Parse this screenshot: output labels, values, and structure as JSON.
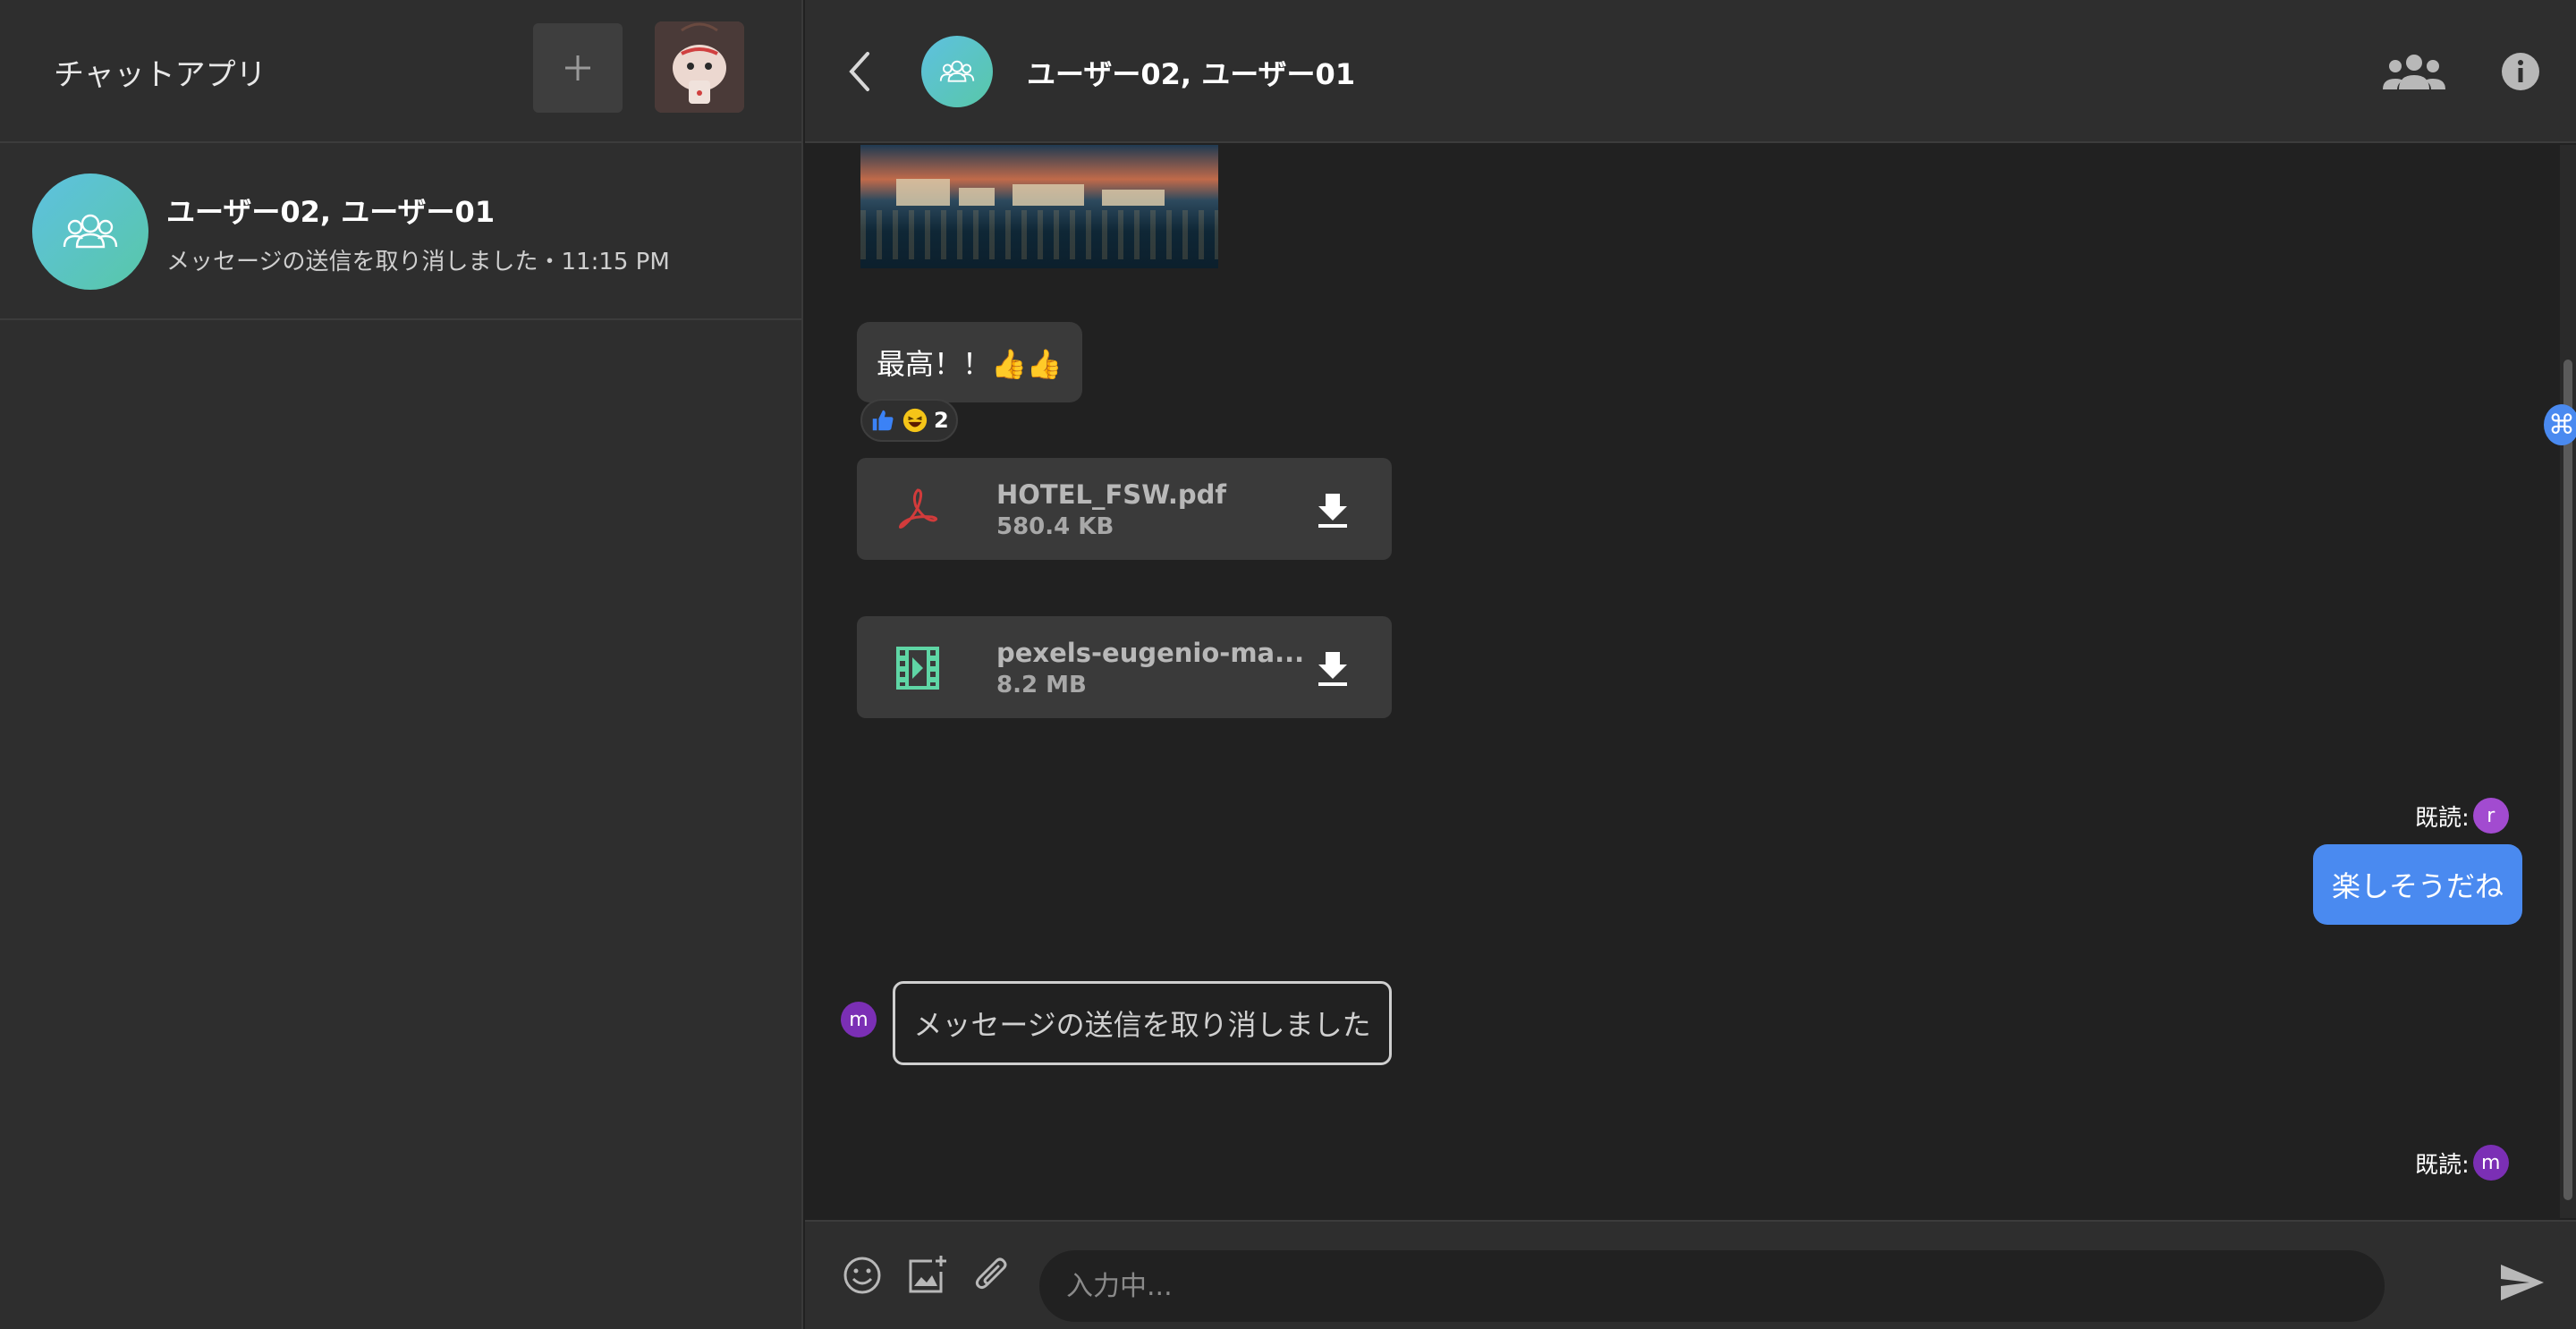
{
  "sidebar": {
    "app_title": "チャットアプリ",
    "rooms": [
      {
        "name": "ユーザー02, ユーザー01",
        "preview": "メッセージの送信を取り消しました・11:15 PM"
      }
    ]
  },
  "chat": {
    "title": "ユーザー02, ユーザー01",
    "messages": {
      "text_1": "最高！！👍👍",
      "reaction_count": "2",
      "files": [
        {
          "name": "HOTEL_FSW.pdf",
          "size": "580.4 KB",
          "icon": "pdf-icon"
        },
        {
          "name": "pexels-eugenio-ma...",
          "size": "8.2 MB",
          "icon": "video-file-icon"
        }
      ],
      "read_label_1": "既読:",
      "read_avatar_1": "r",
      "own_text": "楽しそうだね",
      "sender_avatar": "m",
      "unsent_text": "メッセージの送信を取り消しました",
      "read_label_2": "既読:",
      "read_avatar_2": "m"
    },
    "drag_handle": "⌘"
  },
  "composer": {
    "placeholder": "入力中..."
  },
  "colors": {
    "background": "#212121",
    "panel": "#2e2e2e",
    "bubble": "#3a3a3a",
    "own_bubble": "#4a8af0",
    "accent_gradient_start": "#5ec1e0",
    "accent_gradient_end": "#58c7a8",
    "avatar_r": "#a24bd0",
    "avatar_m": "#7b2fb5"
  }
}
